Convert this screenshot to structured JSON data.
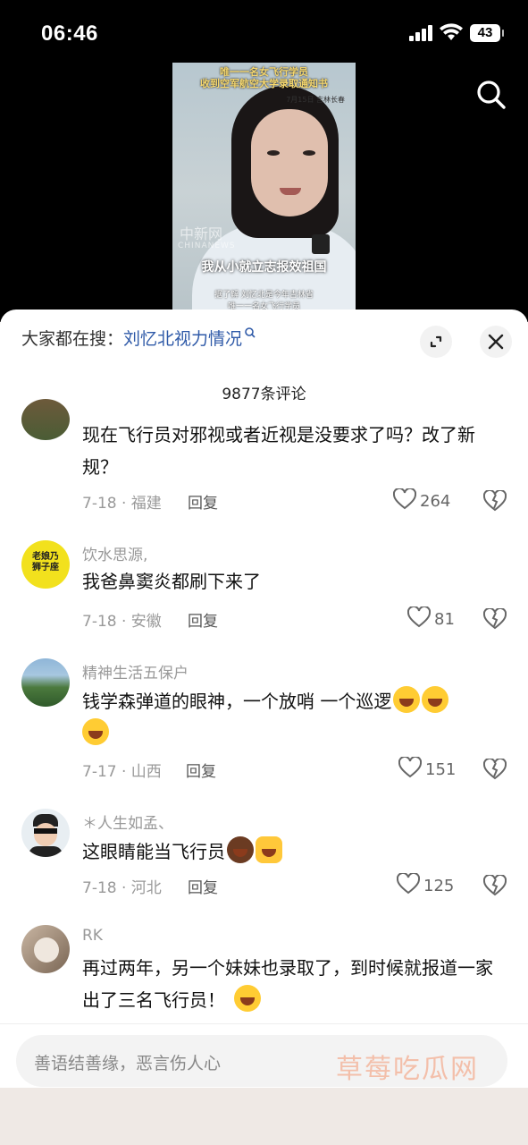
{
  "status": {
    "time": "06:46",
    "battery": "43"
  },
  "video": {
    "caption_line1": "唯一一名女飞行学员",
    "caption_line2": "收到空军航空大学录取通知书",
    "date": "7月15日 吉林长春",
    "watermark": "中新网",
    "watermark_en": "CHINANEWS",
    "subtitle": "我从小就立志报效祖国",
    "sub_line1": "据了解 刘忆北是今年吉林省",
    "sub_line2": "唯一一名女飞行学员"
  },
  "sheet": {
    "search_prefix": "大家都在搜：",
    "search_keyword": "刘忆北视力情况",
    "comment_count": "9877条评论"
  },
  "comments": [
    {
      "text": "现在飞行员对邪视或者近视是没要求了吗？改了新规？",
      "date_loc": "7-18 · 福建",
      "reply": "回复",
      "likes": "264"
    },
    {
      "user": "饮水思源,",
      "text": "我爸鼻窦炎都刷下来了",
      "date_loc": "7-18 · 安徽",
      "reply": "回复",
      "likes": "81"
    },
    {
      "user": "精神生活五保户",
      "text": "钱学森弹道的眼神，一个放哨  一个巡逻",
      "date_loc": "7-17 · 山西",
      "reply": "回复",
      "likes": "151"
    },
    {
      "user": "＊人生如孟、",
      "text": "这眼睛能当飞行员",
      "date_loc": "7-18 · 河北",
      "reply": "回复",
      "likes": "125"
    },
    {
      "user": "RK",
      "text": "再过两年，另一个妹妹也录取了，到时候就报道一家出了三名飞行员！"
    }
  ],
  "input": {
    "placeholder": "善语结善缘，恶言伤人心"
  },
  "site_watermark": "草莓吃瓜网"
}
